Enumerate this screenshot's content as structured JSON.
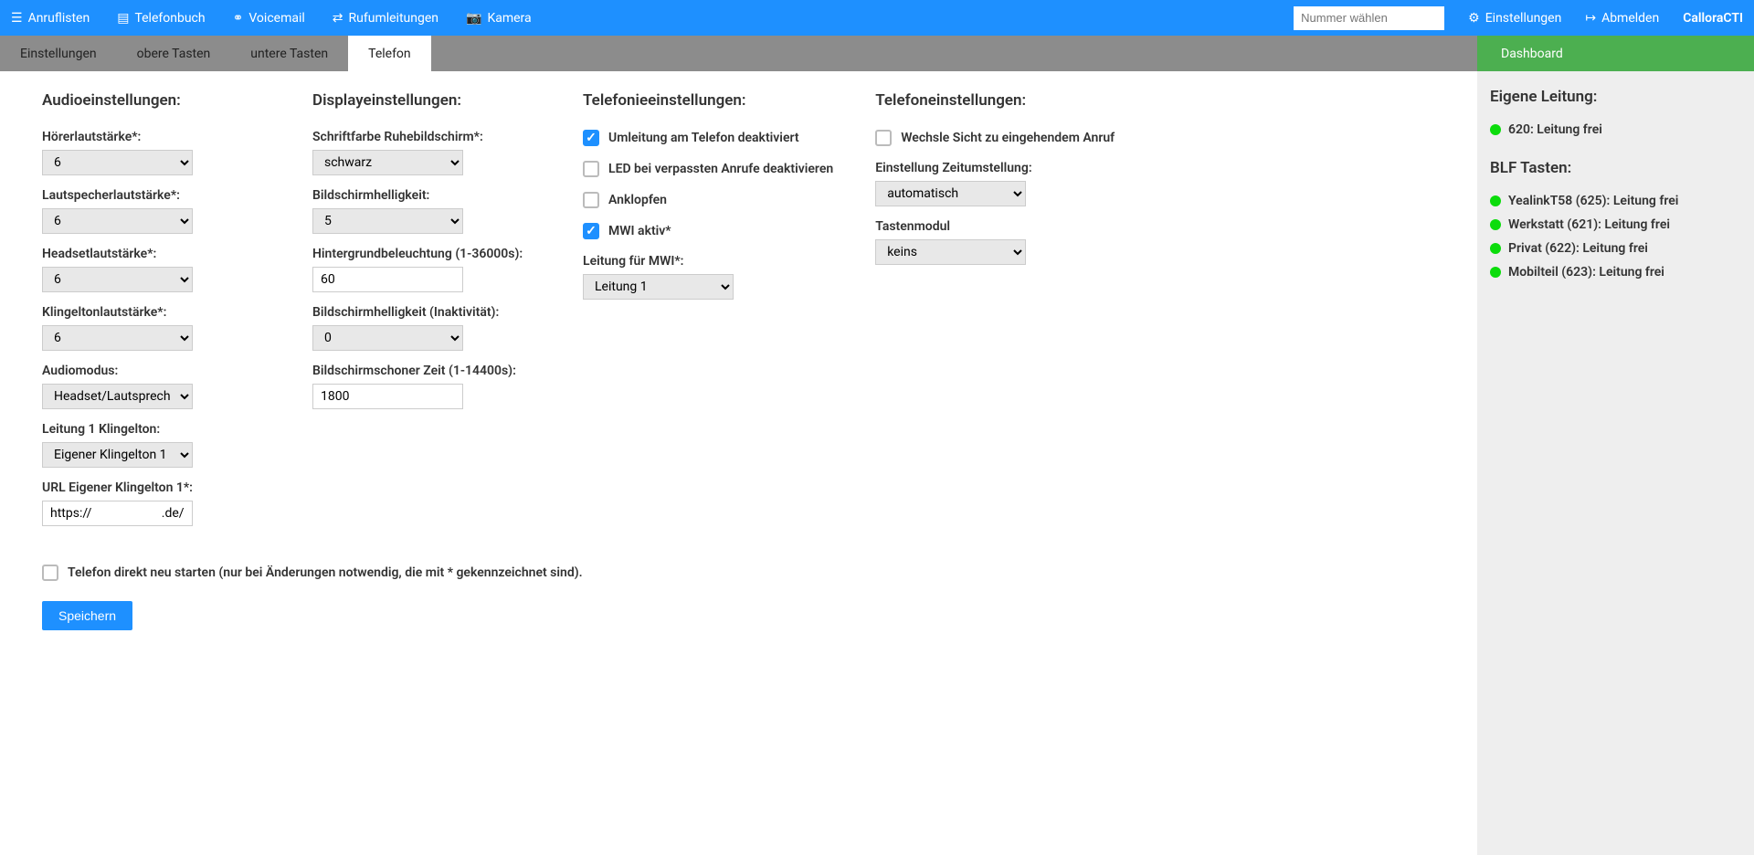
{
  "topbar": {
    "nav": [
      {
        "icon": "list-icon",
        "glyph": "☰",
        "label": "Anruflisten"
      },
      {
        "icon": "phonebook-icon",
        "glyph": "▤",
        "label": "Telefonbuch"
      },
      {
        "icon": "voicemail-icon",
        "glyph": "⚭",
        "label": "Voicemail"
      },
      {
        "icon": "forward-icon",
        "glyph": "⇄",
        "label": "Rufumleitungen"
      },
      {
        "icon": "camera-icon",
        "glyph": "📷",
        "label": "Kamera"
      }
    ],
    "dial_placeholder": "Nummer wählen",
    "settings_label": "Einstellungen",
    "logout_label": "Abmelden",
    "brand": "CalloraCTI"
  },
  "tabs": [
    {
      "label": "Einstellungen",
      "active": false
    },
    {
      "label": "obere Tasten",
      "active": false
    },
    {
      "label": "untere Tasten",
      "active": false
    },
    {
      "label": "Telefon",
      "active": true
    }
  ],
  "dashboard_label": "Dashboard",
  "audio": {
    "heading": "Audioeinstellungen:",
    "handset_label": "Hörerlautstärke*:",
    "handset_value": "6",
    "speaker_label": "Lautspecherlautstärke*:",
    "speaker_value": "6",
    "headset_label": "Headsetlautstärke*:",
    "headset_value": "6",
    "ring_label": "Klingeltonlautstärke*:",
    "ring_value": "6",
    "mode_label": "Audiomodus:",
    "mode_value": "Headset/Lautsprecher",
    "line1ring_label": "Leitung 1 Klingelton:",
    "line1ring_value": "Eigener Klingelton 1",
    "url_label": "URL Eigener Klingelton 1*:",
    "url_value": "https://                      .de/ri"
  },
  "display": {
    "heading": "Displayeinstellungen:",
    "fontcolor_label": "Schriftfarbe Ruhebildschirm*:",
    "fontcolor_value": "schwarz",
    "brightness_label": "Bildschirmhelligkeit:",
    "brightness_value": "5",
    "backlight_label": "Hintergrundbeleuchtung (1-36000s):",
    "backlight_value": "60",
    "idle_brightness_label": "Bildschirmhelligkeit (Inaktivität):",
    "idle_brightness_value": "0",
    "screensaver_label": "Bildschirmschoner Zeit (1-14400s):",
    "screensaver_value": "1800"
  },
  "telephony": {
    "heading": "Telefonieeinstellungen:",
    "forward_off_label": "Umleitung am Telefon deaktiviert",
    "forward_off_checked": true,
    "led_missed_label": "LED bei verpassten Anrufe deaktivieren",
    "led_missed_checked": false,
    "call_waiting_label": "Anklopfen",
    "call_waiting_checked": false,
    "mwi_label": "MWI aktiv*",
    "mwi_checked": true,
    "mwi_line_label": "Leitung für MWI*:",
    "mwi_line_value": "Leitung 1"
  },
  "phone": {
    "heading": "Telefoneinstellungen:",
    "switch_view_label": "Wechsle Sicht zu eingehendem Anruf",
    "switch_view_checked": false,
    "dst_label": "Einstellung Zeitumstellung:",
    "dst_value": "automatisch",
    "keymodule_label": "Tastenmodul",
    "keymodule_value": "keins"
  },
  "restart_label": "Telefon direkt neu starten (nur bei Änderungen notwendig, die mit * gekennzeichnet sind).",
  "save_label": "Speichern",
  "sidebar": {
    "own_line_heading": "Eigene Leitung:",
    "own_line": "620: Leitung frei",
    "blf_heading": "BLF Tasten:",
    "blf": [
      "YealinkT58 (625): Leitung frei",
      "Werkstatt (621): Leitung frei",
      "Privat (622): Leitung frei",
      "Mobilteil (623): Leitung frei"
    ]
  }
}
